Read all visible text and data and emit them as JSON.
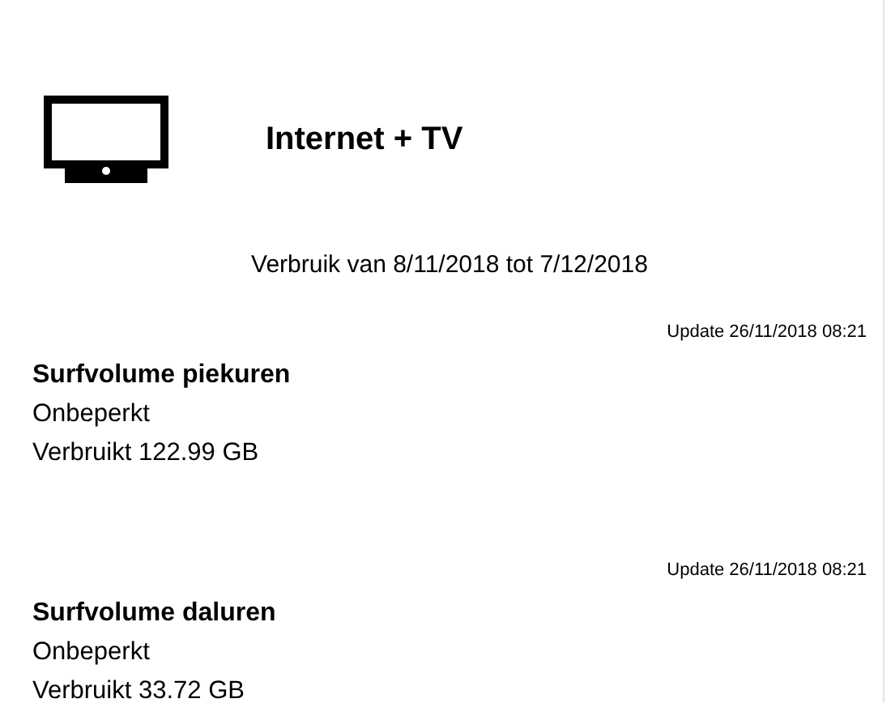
{
  "header": {
    "title": "Internet + TV"
  },
  "period": "Verbruik van 8/11/2018 tot 7/12/2018",
  "sections": [
    {
      "update": "Update 26/11/2018 08:21",
      "title": "Surfvolume piekuren",
      "limit": "Onbeperkt",
      "used": "Verbruikt 122.99 GB"
    },
    {
      "update": "Update 26/11/2018 08:21",
      "title": "Surfvolume daluren",
      "limit": "Onbeperkt",
      "used": "Verbruikt 33.72 GB"
    }
  ]
}
